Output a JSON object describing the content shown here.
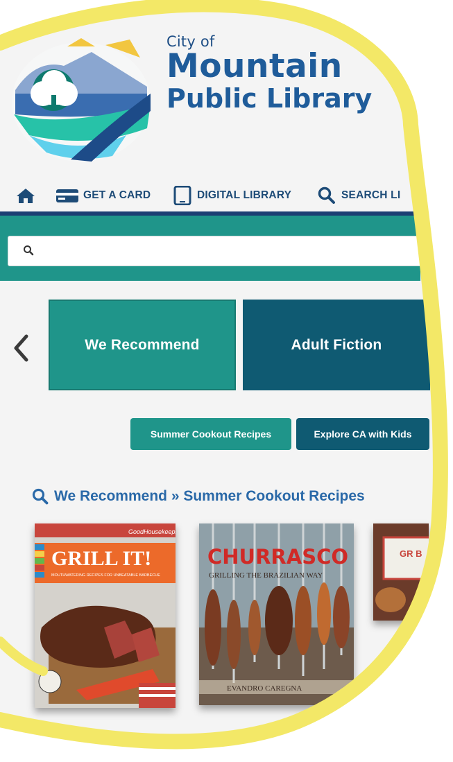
{
  "logo": {
    "line1": "City of",
    "line2": "Mountain",
    "line3": "Public Library"
  },
  "nav": {
    "items": [
      {
        "label": "",
        "icon": "home-icon"
      },
      {
        "label": "GET A CARD",
        "icon": "card-icon"
      },
      {
        "label": "DIGITAL LIBRARY",
        "icon": "tablet-icon"
      },
      {
        "label": "SEARCH LI",
        "icon": "search-icon"
      }
    ]
  },
  "search": {
    "placeholder": ""
  },
  "carousel": {
    "tiles": [
      {
        "label": "We Recommend"
      },
      {
        "label": "Adult Fiction"
      }
    ]
  },
  "chips": [
    {
      "label": "Summer Cookout Recipes"
    },
    {
      "label": "Explore CA with Kids"
    }
  ],
  "section": {
    "title": "We Recommend » Summer Cookout Recipes"
  },
  "books": [
    {
      "brand": "GoodHousekeeping",
      "title": "GRILL IT!",
      "subtitle": "MOUTHWATERING RECIPES FOR UNBEATABLE BARBECUE"
    },
    {
      "title": "CHURRASCO",
      "subtitle": "GRILLING THE BRAZILIAN WAY",
      "author": "EVANDRO CAREGNA"
    },
    {
      "title": "GR B"
    }
  ],
  "colors": {
    "teal": "#1f958a",
    "dark_teal": "#0f5a72",
    "navy": "#1b3f73",
    "title_blue": "#2a69a8",
    "highlight_yellow": "#f3e867"
  }
}
